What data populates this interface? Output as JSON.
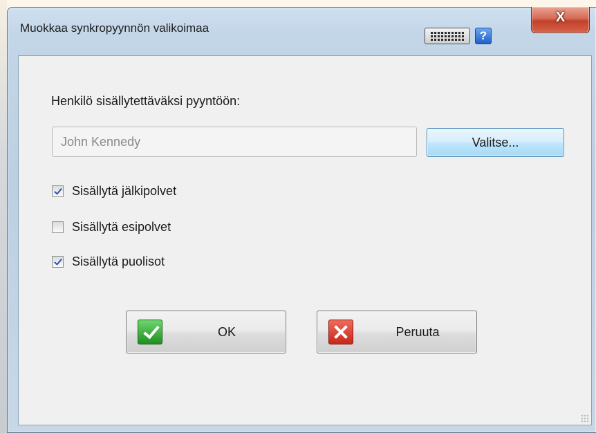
{
  "window": {
    "title": "Muokkaa synkropyynnön valikoimaa",
    "icons": [
      "keyboard-icon",
      "help-icon",
      "close-icon"
    ],
    "help_symbol": "?",
    "close_symbol": "X"
  },
  "form": {
    "person_label": "Henkilö sisällytettäväksi pyyntöön:",
    "person_value": "John Kennedy",
    "choose_button": "Valitse...",
    "checkboxes": [
      {
        "label": "Sisällytä jälkipolvet",
        "checked": true
      },
      {
        "label": "Sisällytä esipolvet",
        "checked": false
      },
      {
        "label": "Sisällytä puolisot",
        "checked": true
      }
    ]
  },
  "buttons": {
    "ok": "OK",
    "cancel": "Peruuta"
  },
  "colors": {
    "accent_button_border": "#3c7fb1",
    "ok_icon": "#2fa52f",
    "cancel_icon": "#d83a2a",
    "close_button": "#c2402a"
  }
}
